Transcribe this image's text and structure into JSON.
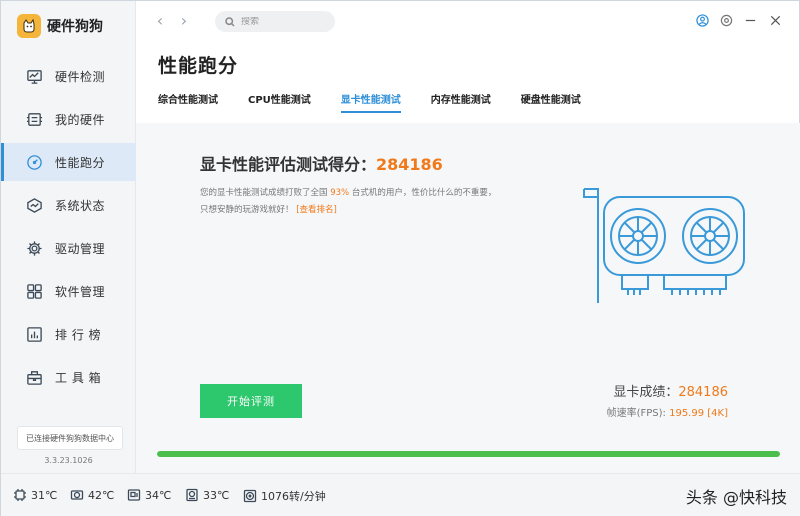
{
  "app": {
    "name": "硬件狗狗"
  },
  "search": {
    "placeholder": "搜索"
  },
  "sidebar": {
    "items": [
      {
        "label": "硬件检测",
        "icon": "monitor-icon"
      },
      {
        "label": "我的硬件",
        "icon": "hardware-icon"
      },
      {
        "label": "性能跑分",
        "icon": "speedometer-icon"
      },
      {
        "label": "系统状态",
        "icon": "system-status-icon"
      },
      {
        "label": "驱动管理",
        "icon": "gear-icon"
      },
      {
        "label": "软件管理",
        "icon": "apps-icon"
      },
      {
        "label": "排 行 榜",
        "icon": "ranking-icon"
      },
      {
        "label": "工 具 箱",
        "icon": "toolbox-icon"
      }
    ],
    "active_index": 2,
    "connect_text": "已连接硬件狗狗数据中心",
    "version": "3.3.23.1026"
  },
  "main": {
    "title": "性能跑分",
    "tabs": [
      {
        "label": "综合性能测试"
      },
      {
        "label": "CPU性能测试"
      },
      {
        "label": "显卡性能测试"
      },
      {
        "label": "内存性能测试"
      },
      {
        "label": "硬盘性能测试"
      }
    ],
    "active_tab": 2,
    "score_label": "显卡性能评估测试得分：",
    "score_value": "284186",
    "desc_part1": "您的显卡性能测试成绩打败了全国 ",
    "desc_percent": "93%",
    "desc_part2": " 台式机的用户，性价比什么的不重要，只想安静的玩游戏就好！",
    "desc_link": "[查看排名]",
    "start_button": "开始评测",
    "result_score_label": "显卡成绩：",
    "result_score_value": "284186",
    "result_fps_label": "帧速率(FPS): ",
    "result_fps_value": "195.99 [4K]",
    "progress_percent": 100
  },
  "status": {
    "cpu_temp": "31℃",
    "gpu_temp": "42℃",
    "board_temp": "34℃",
    "disk_temp": "33℃",
    "fan_speed": "1076转/分钟"
  },
  "watermark": "头条 @快科技",
  "colors": {
    "accent": "#2e8fd8",
    "score": "#f07a1a",
    "start": "#2dc76d",
    "progress": "#4cbe4c"
  }
}
